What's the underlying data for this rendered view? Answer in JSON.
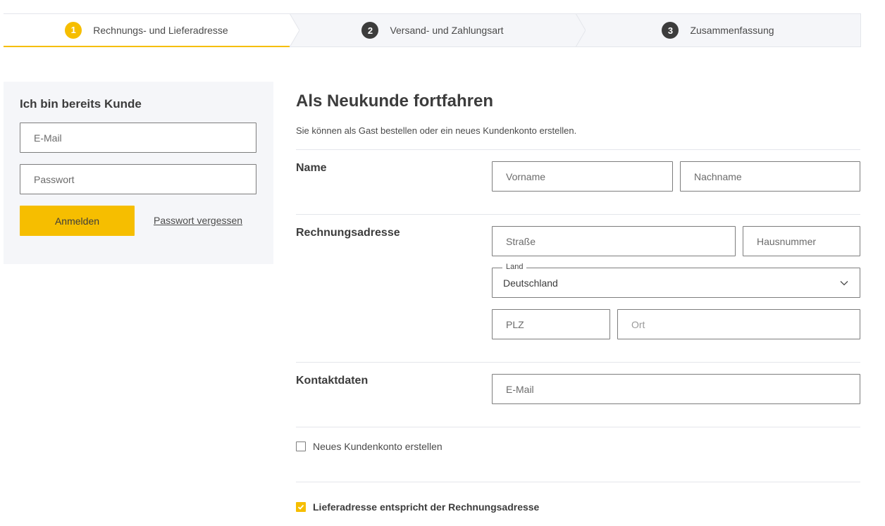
{
  "stepper": {
    "steps": [
      {
        "number": "1",
        "label": "Rechnungs- und Lieferadresse"
      },
      {
        "number": "2",
        "label": "Versand- und Zahlungsart"
      },
      {
        "number": "3",
        "label": "Zusammenfassung"
      }
    ]
  },
  "login": {
    "title": "Ich bin bereits Kunde",
    "email_placeholder": "E-Mail",
    "password_placeholder": "Passwort",
    "submit_label": "Anmelden",
    "forgot_label": "Passwort vergessen"
  },
  "guest": {
    "title": "Als Neukunde fortfahren",
    "subtitle": "Sie können als Gast bestellen oder ein neues Kundenkonto erstellen."
  },
  "name_section": {
    "label": "Name",
    "first_name_placeholder": "Vorname",
    "last_name_placeholder": "Nachname"
  },
  "billing_section": {
    "label": "Rechnungsadresse",
    "street_placeholder": "Straße",
    "house_number_placeholder": "Hausnummer",
    "country_legend": "Land",
    "country_value": "Deutschland",
    "zip_placeholder": "PLZ",
    "city_placeholder": "Ort"
  },
  "contact_section": {
    "label": "Kontaktdaten",
    "email_placeholder": "E-Mail"
  },
  "options": {
    "create_account_label": "Neues Kundenkonto erstellen",
    "create_account_checked": false,
    "same_address_label": "Lieferadresse entspricht der Rechnungsadresse",
    "same_address_checked": true
  },
  "colors": {
    "accent": "#f6be00",
    "panel_bg": "#f5f6f9",
    "text": "#3c3c3c"
  }
}
